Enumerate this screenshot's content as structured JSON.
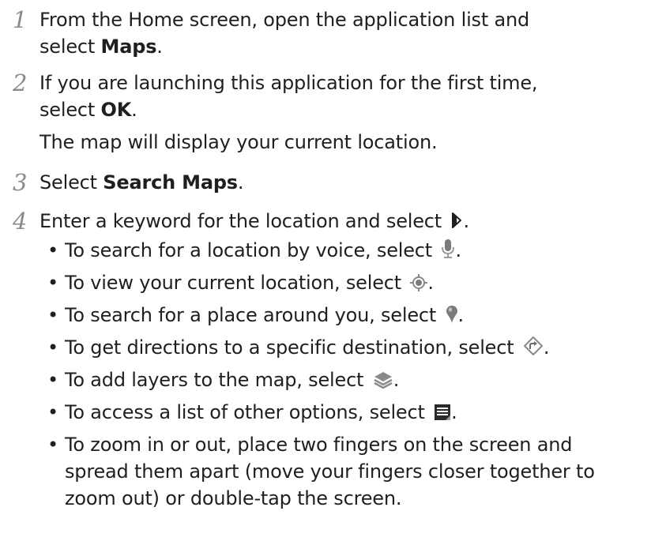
{
  "steps": [
    {
      "number": "1",
      "line1": "From the Home screen, open the application list and",
      "line2_prefix": "select ",
      "line2_bold": "Maps",
      "line2_suffix": "."
    },
    {
      "number": "2",
      "line1": "If you are launching this application for the first time,",
      "line2_prefix": "select ",
      "line2_bold": "OK",
      "line2_suffix": ".",
      "line3": "The map will display your current location."
    },
    {
      "number": "3",
      "prefix": "Select ",
      "bold": "Search Maps",
      "suffix": "."
    },
    {
      "number": "4",
      "prefix": "Enter a keyword for the location and select ",
      "icon": "play-arrow-icon",
      "suffix": "."
    }
  ],
  "bullets": [
    {
      "text": "To search for a location by voice, select ",
      "icon": "microphone-icon",
      "suffix": "."
    },
    {
      "text": "To view your current location, select ",
      "icon": "my-location-icon",
      "suffix": "."
    },
    {
      "text": "To search for a place around you, select ",
      "icon": "place-pin-icon",
      "suffix": "."
    },
    {
      "text": "To get directions to a specific destination, select ",
      "icon": "directions-icon",
      "suffix": "."
    },
    {
      "text": "To add layers to the map, select ",
      "icon": "layers-icon",
      "suffix": "."
    },
    {
      "text": "To access a list of other options, select ",
      "icon": "menu-icon",
      "suffix": "."
    },
    {
      "line1": "To zoom in or out, place two fingers on the screen and",
      "line2": "spread them apart (move your fingers closer together to",
      "line3": "zoom out) or double-tap the screen."
    }
  ],
  "bullet_symbol": "•",
  "colors": {
    "text": "#1f1f1f",
    "step_number": "#8a8a8a",
    "icon": "#7a7a7a"
  }
}
